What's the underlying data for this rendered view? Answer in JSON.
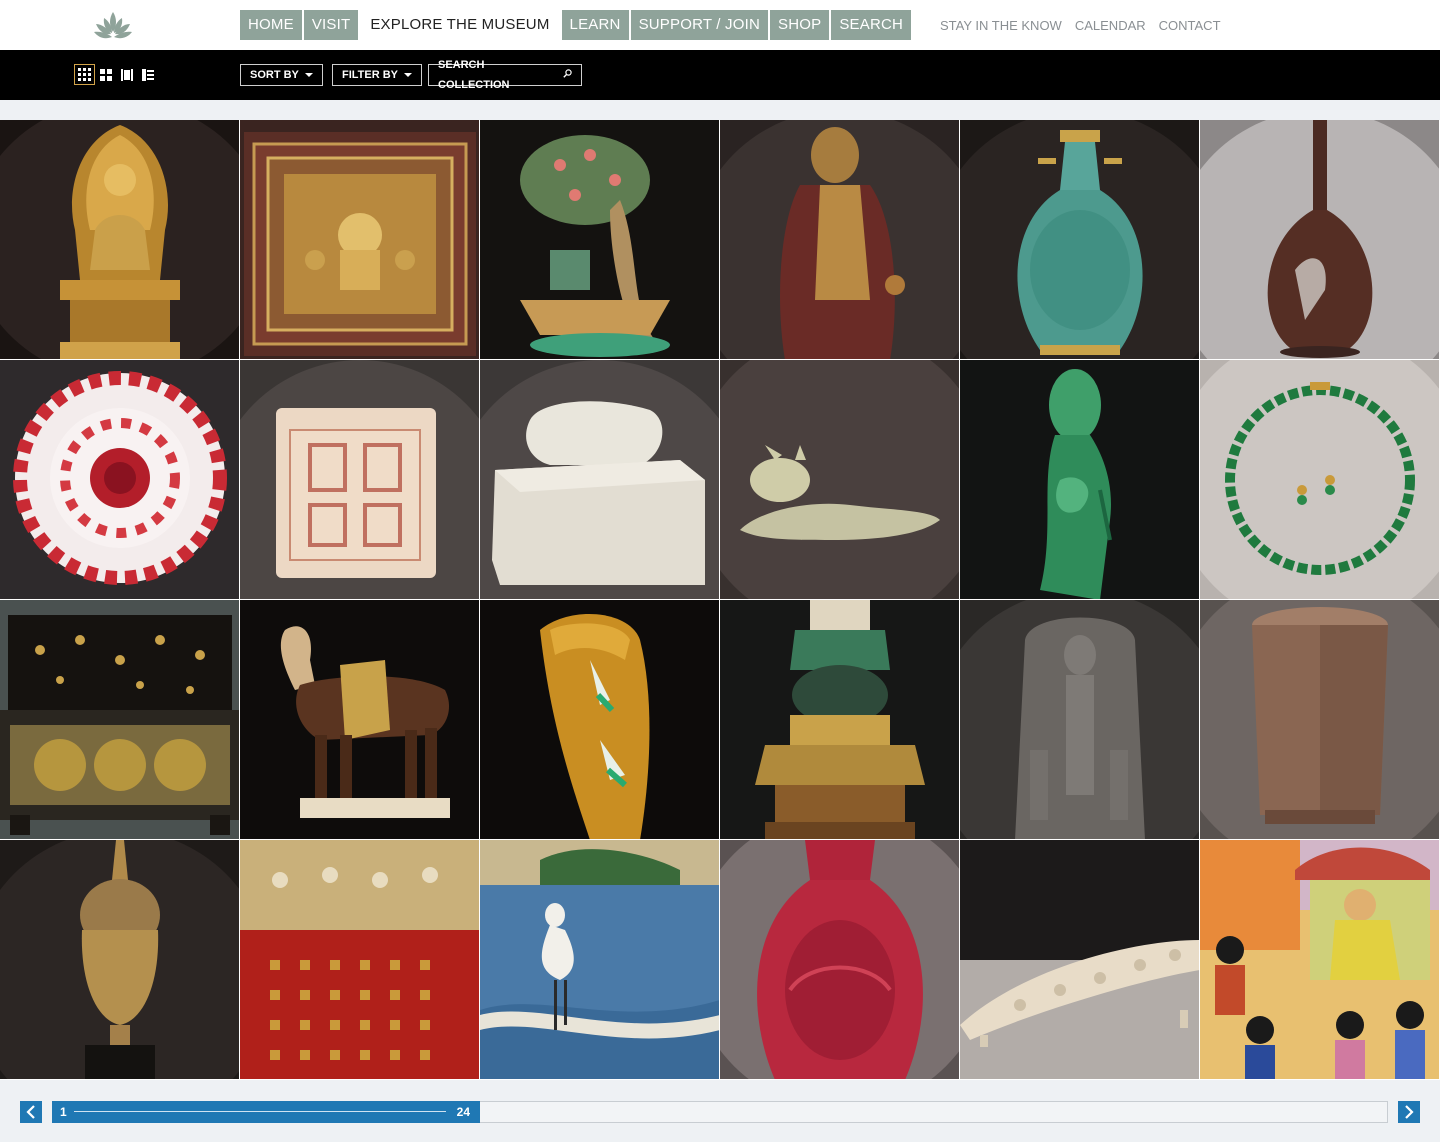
{
  "nav": {
    "main": [
      {
        "label": "HOME"
      },
      {
        "label": "VISIT"
      },
      {
        "label": "EXPLORE THE MUSEUM"
      },
      {
        "label": "LEARN"
      },
      {
        "label": "SUPPORT / JOIN"
      },
      {
        "label": "SHOP"
      },
      {
        "label": "SEARCH"
      }
    ],
    "active_index": 2,
    "utility": [
      {
        "label": "STAY IN THE KNOW"
      },
      {
        "label": "CALENDAR"
      },
      {
        "label": "CONTACT"
      }
    ]
  },
  "toolbar": {
    "views": [
      "grid-small-view-icon",
      "grid-large-view-icon",
      "single-view-icon",
      "list-view-icon"
    ],
    "active_view": 0,
    "sort_label": "SORT BY",
    "filter_label": "FILTER BY",
    "search_label": "SEARCH COLLECTION"
  },
  "collection": {
    "tiles": [
      {
        "name": "gilt-bronze-deity-shrine"
      },
      {
        "name": "jeweled-relief-panel"
      },
      {
        "name": "jade-tree-boat-sculpture"
      },
      {
        "name": "lacquered-monk-figure"
      },
      {
        "name": "cloisonne-vase"
      },
      {
        "name": "bronze-crane-bottle-vase"
      },
      {
        "name": "red-glass-dish"
      },
      {
        "name": "stone-seal"
      },
      {
        "name": "jade-dragon-seal"
      },
      {
        "name": "jade-recumbent-animal"
      },
      {
        "name": "green-jade-dragon-carving"
      },
      {
        "name": "jade-bead-necklace"
      },
      {
        "name": "lacquer-chest"
      },
      {
        "name": "sancai-glazed-horse"
      },
      {
        "name": "amber-gourd-carving"
      },
      {
        "name": "enameled-stand-vessel"
      },
      {
        "name": "stone-deity-stele"
      },
      {
        "name": "stone-cong-vessel"
      },
      {
        "name": "bronze-buddha-head"
      },
      {
        "name": "red-embroidered-textile"
      },
      {
        "name": "crane-folding-screen"
      },
      {
        "name": "carved-cinnabar-vase"
      },
      {
        "name": "carved-ivory-tusk"
      },
      {
        "name": "persian-court-painting"
      }
    ]
  },
  "pager": {
    "start": "1",
    "end": "24",
    "progress": 0.32
  },
  "colors": {
    "nav_bg": "#8fa39a",
    "toolbar_bg": "#000000",
    "accent_blue": "#1f78b4",
    "active_view_border": "#d2a44a"
  }
}
